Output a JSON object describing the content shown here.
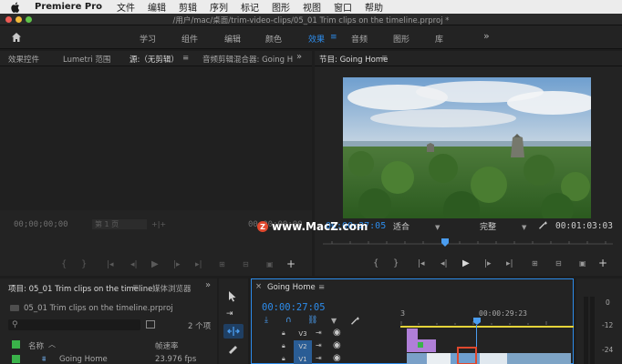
{
  "menubar": {
    "app": "Premiere Pro",
    "items": [
      "文件",
      "编辑",
      "剪辑",
      "序列",
      "标记",
      "图形",
      "视图",
      "窗口",
      "帮助"
    ]
  },
  "window": {
    "title": "/用户/mac/桌面/trim-video-clips/05_01 Trim clips on the timeline.prproj *"
  },
  "workspaces": {
    "items": [
      "学习",
      "组件",
      "编辑",
      "颜色",
      "效果",
      "音频",
      "图形",
      "库"
    ],
    "active": "效果",
    "more": "»"
  },
  "source_panel": {
    "tabs": [
      "效果控件",
      "Lumetri 范围",
      "源:（无剪辑）",
      "音频剪辑混合器: Going H"
    ],
    "active_tab": "源:（无剪辑）",
    "menu": "≡",
    "more": "»",
    "timecode": "00;00;00;00",
    "page": "第 1 页",
    "timecode_right": "00;00;00;00"
  },
  "program_panel": {
    "title": "节目: Going Home",
    "menu": "≡",
    "timecode": "00:00:27:05",
    "fit": "适合",
    "quality": "完整",
    "duration": "00:01:03:03"
  },
  "watermark": {
    "badge": "Z",
    "text": "www.MacZ.com"
  },
  "project_panel": {
    "tab": "项目: 05_01 Trim clips on the timeline",
    "tab2": "媒体浏览器",
    "menu": "≡",
    "more": "»",
    "file": "05_01 Trim clips on the timeline.prproj",
    "item_count": "2 个项",
    "col_name": "名称",
    "col_rate": "帧速率",
    "row_name": "Going Home",
    "row_rate": "23.976 fps"
  },
  "timeline_panel": {
    "tab": "Going Home",
    "menu": "≡",
    "timecode": "00:00:27:05",
    "ruler_start": "3",
    "ruler_mark": "00:00:29:23",
    "tracks": [
      "V3",
      "V2",
      "V1"
    ]
  },
  "audio_meter": {
    "labels": [
      "0",
      "-12",
      "-24"
    ]
  },
  "colors": {
    "accent": "#2d8ceb",
    "clip_violet": "#b07fd8",
    "clip_red": "#e0482e",
    "track_blue": "#2a5d95",
    "green_label": "#3ab34a",
    "playhead": "#4a9df0",
    "workarea": "#e5d43a"
  }
}
